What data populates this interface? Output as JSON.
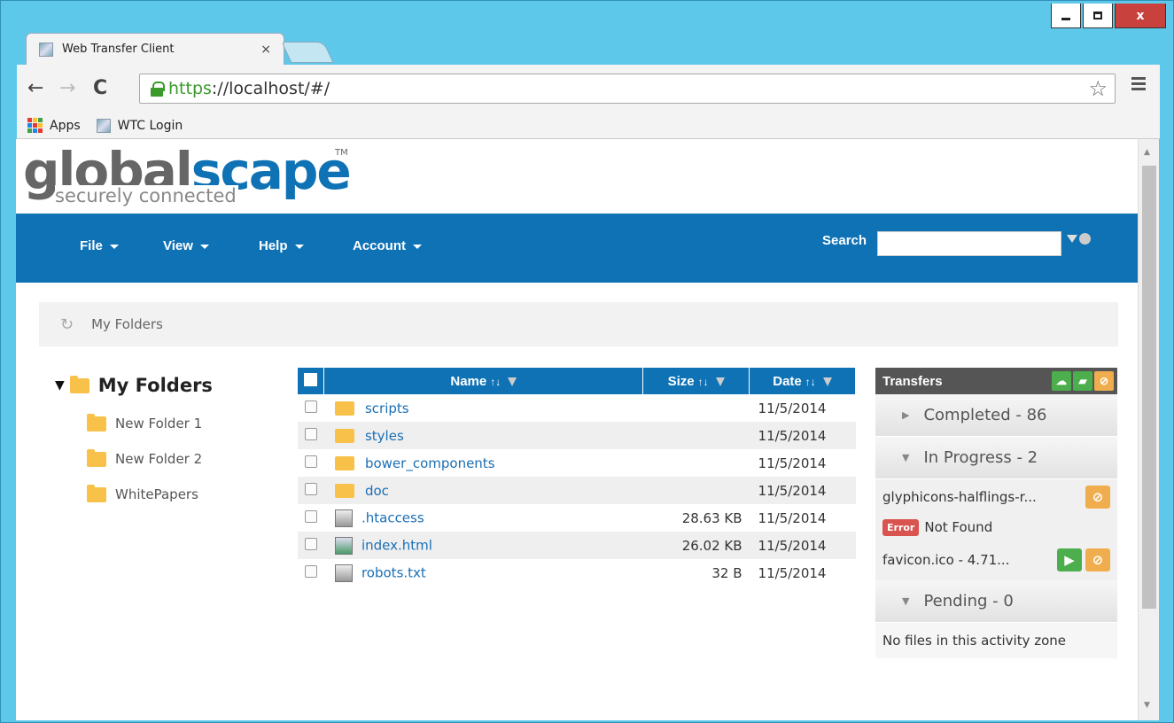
{
  "browser": {
    "tab_title": "Web Transfer Client",
    "tab_close": "×",
    "url_scheme": "https",
    "url_rest": "://localhost/#/",
    "bookmarks": {
      "apps": "Apps",
      "wtc_login": "WTC Login"
    }
  },
  "logo": {
    "part1": "global",
    "part2": "scape",
    "tm": "TM",
    "tagline": "securely connected"
  },
  "nav": {
    "menus": [
      "File",
      "View",
      "Help",
      "Account"
    ],
    "search_label": "Search",
    "search_value": ""
  },
  "breadcrumb": {
    "label": "My Folders"
  },
  "tree": {
    "root": "My Folders",
    "children": [
      "New Folder 1",
      "New Folder 2",
      "WhitePapers"
    ]
  },
  "table": {
    "headers": {
      "name": "Name",
      "size": "Size",
      "date": "Date"
    },
    "rows": [
      {
        "type": "folder",
        "name": "scripts",
        "size": "",
        "date": "11/5/2014"
      },
      {
        "type": "folder",
        "name": "styles",
        "size": "",
        "date": "11/5/2014"
      },
      {
        "type": "folder",
        "name": "bower_components",
        "size": "",
        "date": "11/5/2014"
      },
      {
        "type": "folder",
        "name": "doc",
        "size": "",
        "date": "11/5/2014"
      },
      {
        "type": "file",
        "name": ".htaccess",
        "size": "28.63 KB",
        "date": "11/5/2014"
      },
      {
        "type": "html",
        "name": "index.html",
        "size": "26.02 KB",
        "date": "11/5/2014"
      },
      {
        "type": "file",
        "name": "robots.txt",
        "size": "32 B",
        "date": "11/5/2014"
      }
    ]
  },
  "transfers": {
    "title": "Transfers",
    "completed": "Completed - 86",
    "in_progress": "In Progress - 2",
    "item1": "glyphicons-halflings-r...",
    "error_badge": "Error",
    "error_text": "Not Found",
    "item2": "favicon.ico - 4.71...",
    "pending": "Pending - 0",
    "empty_note": "No files in this activity zone"
  },
  "colors": {
    "brand_blue": "#0e72b5",
    "error_red": "#d9534f",
    "ok_green": "#4cae4c",
    "warn_orange": "#f0ad4e"
  }
}
